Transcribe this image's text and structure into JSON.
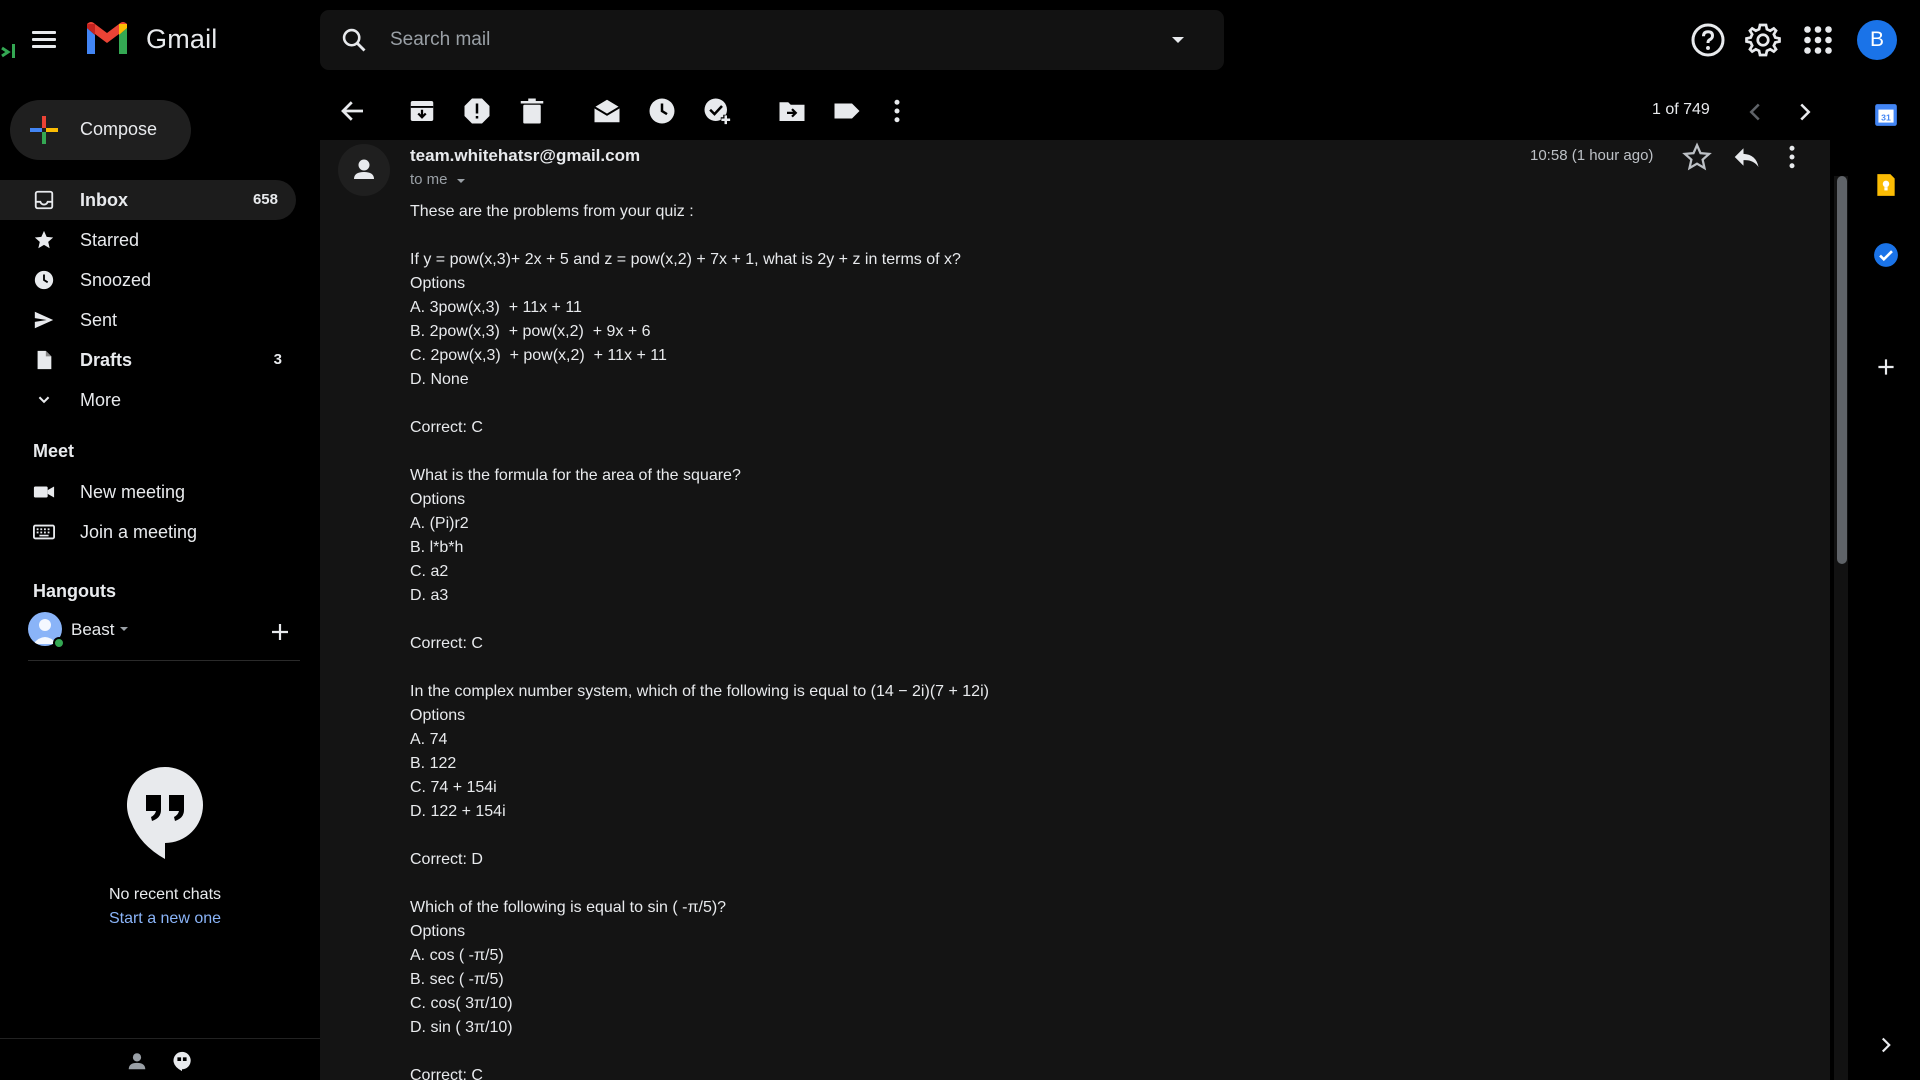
{
  "app": {
    "name": "Gmail"
  },
  "search": {
    "placeholder": "Search mail"
  },
  "compose": {
    "label": "Compose"
  },
  "nav": [
    {
      "label": "Inbox",
      "count": "658",
      "icon": "inbox-icon"
    },
    {
      "label": "Starred",
      "count": "",
      "icon": "star-icon"
    },
    {
      "label": "Snoozed",
      "count": "",
      "icon": "clock-icon"
    },
    {
      "label": "Sent",
      "count": "",
      "icon": "send-icon"
    },
    {
      "label": "Drafts",
      "count": "3",
      "icon": "draft-icon"
    },
    {
      "label": "More",
      "count": "",
      "icon": "chevron-down-icon"
    }
  ],
  "meet": {
    "title": "Meet",
    "items": [
      {
        "label": "New meeting",
        "icon": "video-icon"
      },
      {
        "label": "Join a meeting",
        "icon": "keyboard-icon"
      }
    ]
  },
  "hangouts": {
    "title": "Hangouts",
    "user": "Beast",
    "empty_text": "No recent chats",
    "start_link": "Start a new one"
  },
  "toolbar": {
    "pager": "1 of 749"
  },
  "email": {
    "sender": "team.whitehatsr@gmail.com",
    "to": "to me",
    "time": "10:58 (1 hour ago)",
    "lines": [
      "These are the problems from your quiz :",
      "",
      "If y = pow(x,3)+ 2x + 5 and z = pow(x,2) + 7x + 1, what is 2y + z in terms of x?",
      "Options",
      "A. 3pow(x,3)  + 11x + 11",
      "B. 2pow(x,3)  + pow(x,2)  + 9x + 6",
      "C. 2pow(x,3)  + pow(x,2)  + 11x + 11",
      "D. None",
      "",
      "Correct: C",
      "",
      "What is the formula for the area of the square?",
      "Options",
      "A. (Pi)r2",
      "B. l*b*h",
      "C. a2",
      "D. a3",
      "",
      "Correct: C",
      "",
      "In the complex number system, which of the following is equal to (14 − 2i)(7 + 12i)",
      "Options",
      "A. 74",
      "B. 122",
      "C. 74 + 154i",
      "D. 122 + 154i",
      "",
      "Correct: D",
      "",
      "Which of the following is equal to sin ( -π/5)?",
      "Options",
      "A. cos ( -π/5)",
      "B. sec ( -π/5)",
      "C. cos( 3π/10)",
      "D. sin ( 3π/10)",
      "",
      "Correct: C"
    ]
  },
  "account": {
    "initial": "B"
  },
  "colors": {
    "accent": "#1a73e8",
    "link": "#8ab4f8",
    "online": "#34a853"
  }
}
